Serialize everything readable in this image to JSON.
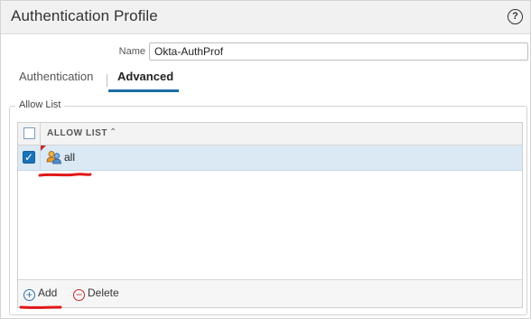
{
  "dialog": {
    "title": "Authentication Profile",
    "help_icon": "?"
  },
  "name_field": {
    "label": "Name",
    "value": "Okta-AuthProf"
  },
  "tabs": [
    {
      "label": "Authentication",
      "active": false
    },
    {
      "label": "Advanced",
      "active": true
    }
  ],
  "allow_list": {
    "legend": "Allow List",
    "column_header": "ALLOW LIST",
    "sort_icon": "chevron-up-icon",
    "rows": [
      {
        "value": "all",
        "checked": true,
        "icon": "users-group-icon"
      }
    ],
    "footer": {
      "add_label": "Add",
      "delete_label": "Delete"
    }
  },
  "colors": {
    "accent": "#1c6ea4",
    "selected_row": "#dbe9f5",
    "annotation": "#e01818"
  }
}
